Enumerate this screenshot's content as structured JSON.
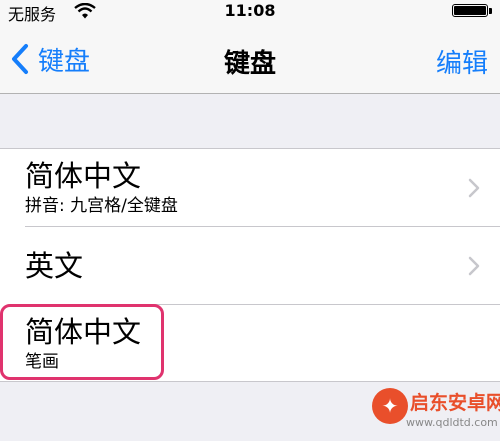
{
  "status_bar": {
    "carrier": "无服务",
    "time": "11:08"
  },
  "nav": {
    "back_label": "键盘",
    "title": "键盘",
    "edit_label": "编辑"
  },
  "keyboards": [
    {
      "title": "简体中文",
      "subtitle": "拼音: 九宫格/全键盘",
      "has_chevron": true
    },
    {
      "title": "英文",
      "subtitle": "",
      "has_chevron": true
    },
    {
      "title": "简体中文",
      "subtitle": "笔画",
      "has_chevron": false,
      "highlighted": true
    }
  ],
  "watermark": {
    "name": "启东安卓网",
    "url": "www.qdldtd.com"
  },
  "colors": {
    "accent": "#157efb",
    "highlight": "#e0336e",
    "background": "#efeff4"
  }
}
